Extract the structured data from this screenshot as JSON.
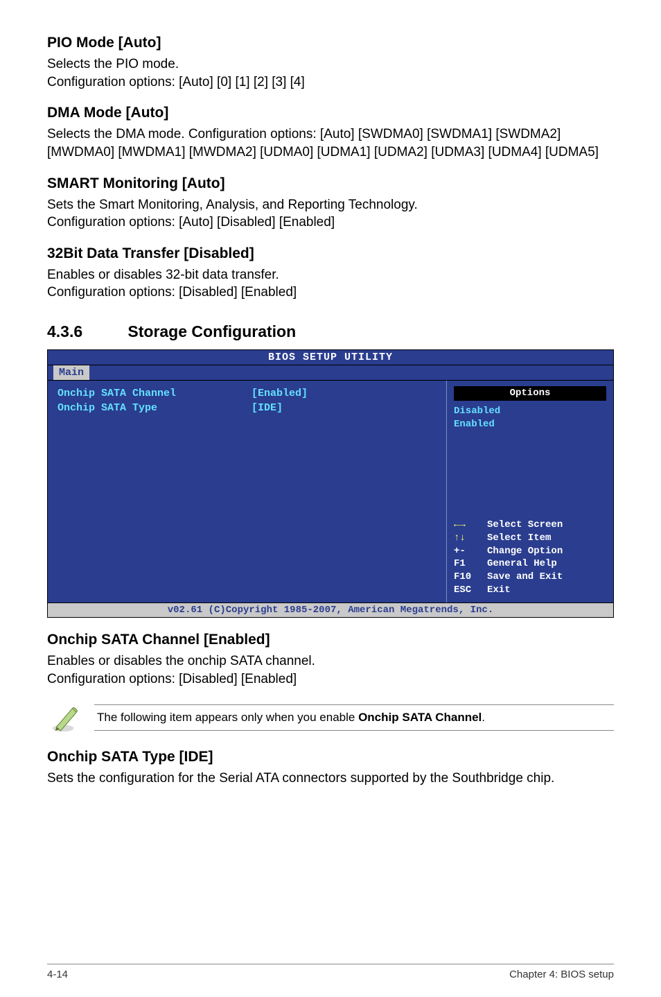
{
  "sections": {
    "pio": {
      "title": "PIO Mode [Auto]",
      "body": "Selects the PIO mode.\nConfiguration options: [Auto] [0] [1] [2] [3] [4]"
    },
    "dma": {
      "title": "DMA Mode [Auto]",
      "body": "Selects the DMA mode. Configuration options: [Auto] [SWDMA0] [SWDMA1] [SWDMA2] [MWDMA0] [MWDMA1] [MWDMA2] [UDMA0] [UDMA1] [UDMA2] [UDMA3] [UDMA4] [UDMA5]"
    },
    "smart": {
      "title": "SMART Monitoring [Auto]",
      "body": "Sets the Smart Monitoring, Analysis, and Reporting Technology.\nConfiguration options: [Auto] [Disabled] [Enabled]"
    },
    "bit32": {
      "title": "32Bit Data Transfer [Disabled]",
      "body": "Enables or disables 32-bit data transfer.\nConfiguration options: [Disabled] [Enabled]"
    },
    "storage_heading_num": "4.3.6",
    "storage_heading": "Storage Configuration",
    "onchip_channel": {
      "title": "Onchip SATA Channel [Enabled]",
      "body": "Enables or disables the onchip SATA channel.\nConfiguration options: [Disabled] [Enabled]"
    },
    "onchip_type": {
      "title": "Onchip SATA Type [IDE]",
      "body": "Sets the configuration for the Serial ATA connectors supported by the Southbridge chip."
    }
  },
  "bios": {
    "header": "BIOS SETUP UTILITY",
    "tab": "Main",
    "rows": [
      {
        "label": "Onchip SATA Channel",
        "value": "[Enabled]"
      },
      {
        "label": "Onchip SATA Type",
        "value": "[IDE]"
      }
    ],
    "options_header": "Options",
    "options": [
      "Disabled",
      "Enabled"
    ],
    "hints": [
      {
        "key": "←→",
        "desc": "Select Screen",
        "arrow": true
      },
      {
        "key": "↑↓",
        "desc": "Select Item",
        "arrow": true
      },
      {
        "key": "+-",
        "desc": "Change Option"
      },
      {
        "key": "F1",
        "desc": "General Help"
      },
      {
        "key": "F10",
        "desc": "Save and Exit"
      },
      {
        "key": "ESC",
        "desc": "Exit"
      }
    ],
    "footer": "v02.61 (C)Copyright 1985-2007, American Megatrends, Inc."
  },
  "note": {
    "text_prefix": "The following item appears only when you enable ",
    "text_bold": "Onchip SATA Channel",
    "text_suffix": "."
  },
  "footer": {
    "left": "4-14",
    "right": "Chapter 4: BIOS setup"
  }
}
